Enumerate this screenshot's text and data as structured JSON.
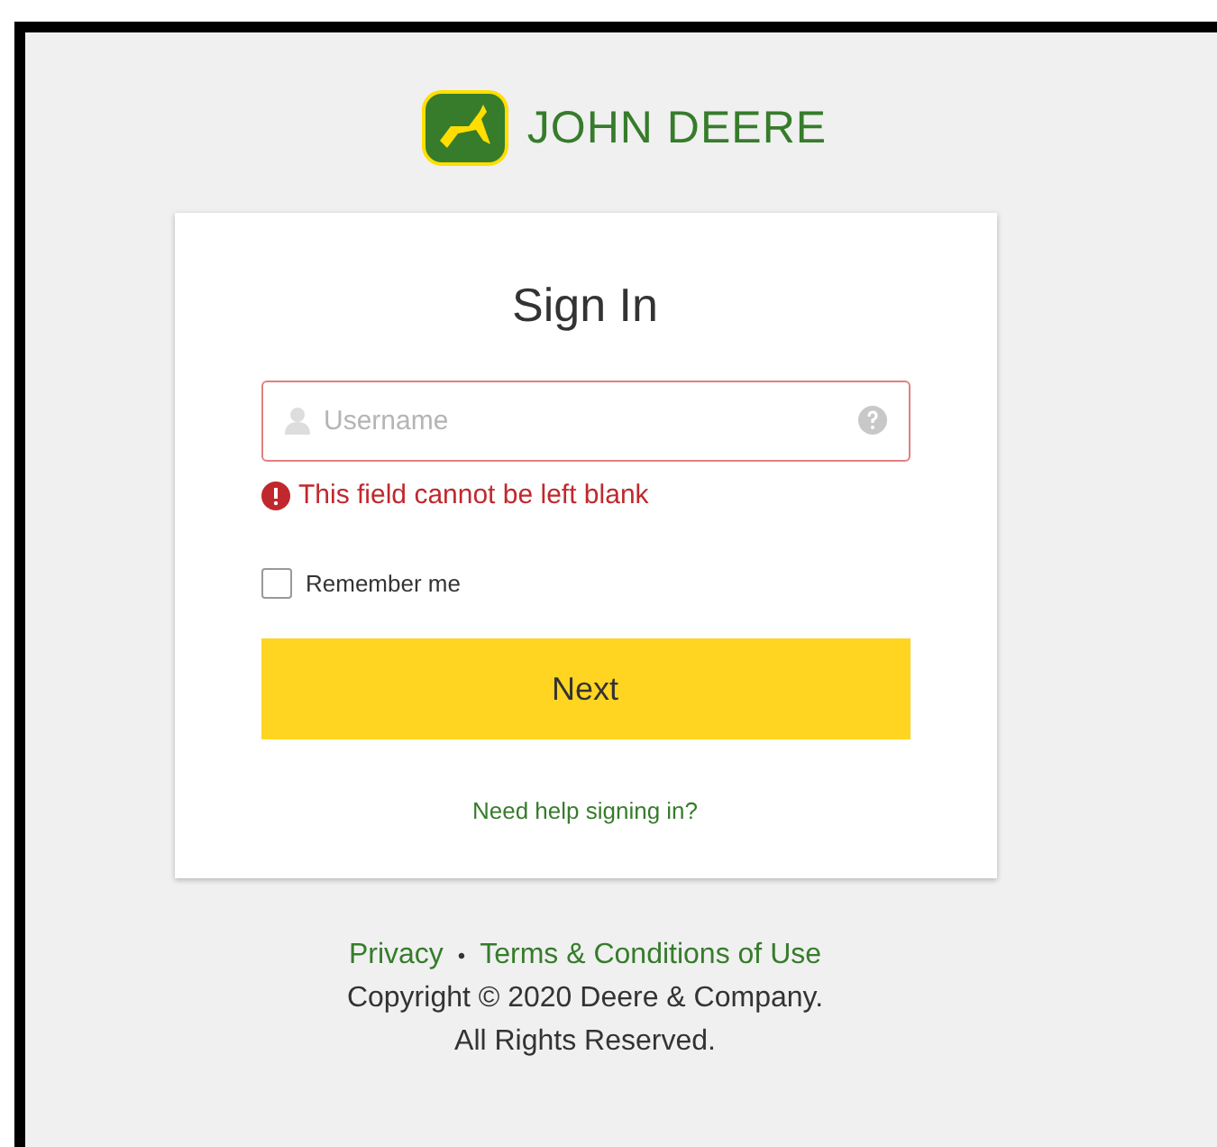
{
  "brand": {
    "name": "JOHN DEERE"
  },
  "card": {
    "title": "Sign In",
    "username": {
      "placeholder": "Username",
      "invalid": true
    },
    "error": "This field cannot be left blank",
    "remember": {
      "label": "Remember me",
      "checked": false
    },
    "button": "Next",
    "help_link": "Need help signing in?"
  },
  "footer": {
    "links": [
      "Privacy",
      "Terms & Conditions of Use"
    ],
    "separator": "•",
    "copyright": "Copyright © 2020 Deere & Company.",
    "rights": "All Rights Reserved."
  }
}
